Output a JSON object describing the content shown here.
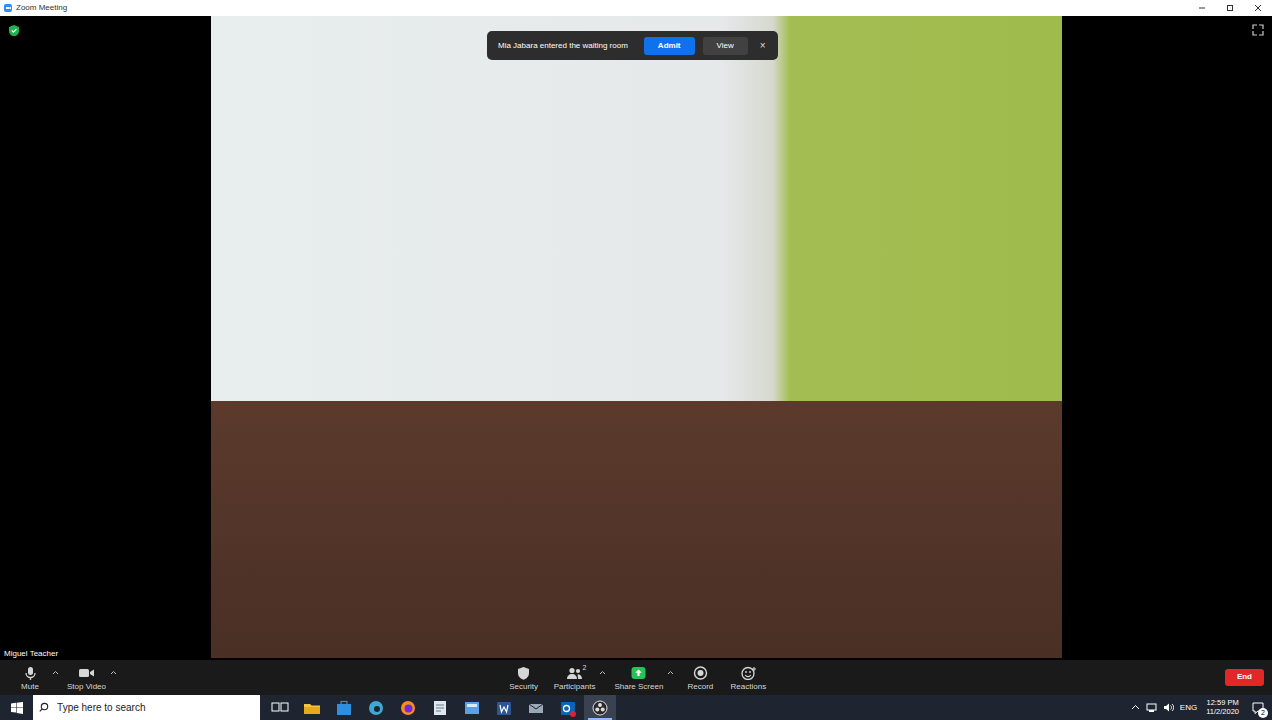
{
  "window": {
    "title": "Zoom Meeting"
  },
  "notification": {
    "text": "Mia Jabara entered the waiting room",
    "buttons": [
      {
        "label": "Admit",
        "primary": true
      },
      {
        "label": "View",
        "primary": false
      }
    ],
    "close": "×"
  },
  "video": {
    "participant": "Miguel Teacher"
  },
  "toolbar": {
    "left": [
      {
        "label": "Mute",
        "kind": "mic",
        "has_menu": true
      },
      {
        "label": "Stop Video",
        "kind": "camera",
        "has_menu": true
      }
    ],
    "center": [
      {
        "label": "Security",
        "kind": "shield",
        "has_menu": false
      },
      {
        "label": "Participants",
        "kind": "people",
        "has_menu": true,
        "count": "2"
      },
      {
        "label": "Share Screen",
        "kind": "share",
        "has_menu": true
      },
      {
        "label": "Record",
        "kind": "record",
        "has_menu": false
      },
      {
        "label": "Reactions",
        "kind": "reaction",
        "has_menu": false
      }
    ],
    "end": "End"
  },
  "taskbar": {
    "search": {
      "placeholder": "Type here to search"
    },
    "apps": [
      {
        "kind": "taskview",
        "selected": false
      },
      {
        "kind": "explorer",
        "selected": false
      },
      {
        "kind": "store",
        "selected": false
      },
      {
        "kind": "edge",
        "selected": false
      },
      {
        "kind": "firefox",
        "selected": false
      },
      {
        "kind": "notes",
        "selected": false
      },
      {
        "kind": "files",
        "selected": false
      },
      {
        "kind": "word",
        "selected": false
      },
      {
        "kind": "mail",
        "selected": false
      },
      {
        "kind": "outlook",
        "selected": false
      },
      {
        "kind": "obs",
        "selected": true
      }
    ],
    "language": "ENG",
    "time": "12:59 PM",
    "date": "11/2/2020",
    "notifications": "2"
  }
}
